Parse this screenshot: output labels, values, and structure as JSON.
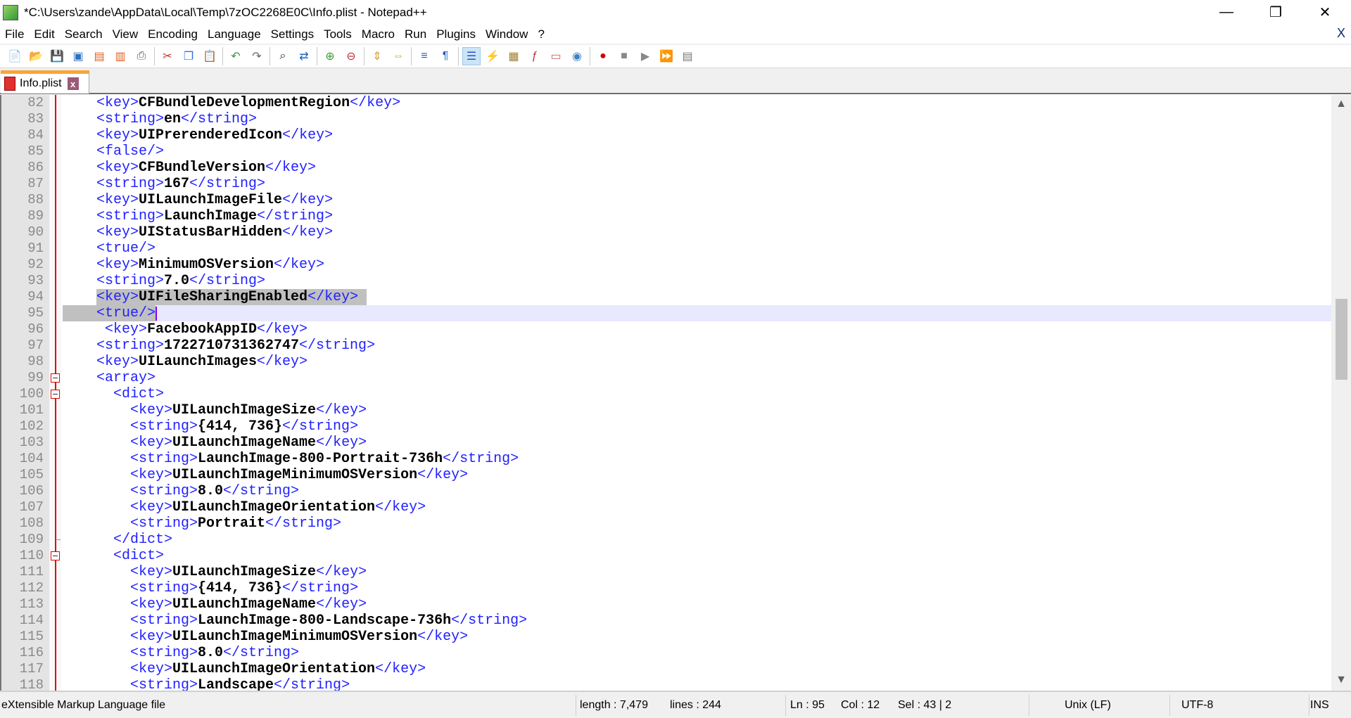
{
  "window": {
    "title": "*C:\\Users\\zande\\AppData\\Local\\Temp\\7zOC2268E0C\\Info.plist - Notepad++",
    "minimize": "—",
    "restore": "❐",
    "close": "✕"
  },
  "menu": {
    "items": [
      "File",
      "Edit",
      "Search",
      "View",
      "Encoding",
      "Language",
      "Settings",
      "Tools",
      "Macro",
      "Run",
      "Plugins",
      "Window",
      "?"
    ],
    "close": "X"
  },
  "toolbar": {
    "icons": [
      "new-file",
      "open-file",
      "save",
      "save-all",
      "close",
      "close-all",
      "print",
      "|",
      "cut",
      "copy",
      "paste",
      "|",
      "undo",
      "redo",
      "|",
      "find",
      "replace",
      "|",
      "zoom-in",
      "zoom-out",
      "|",
      "sync-vertical",
      "sync-horizontal",
      "|",
      "word-wrap",
      "show-all-chars",
      "|",
      "indent-guide",
      "user-language",
      "document-map",
      "function-list",
      "folder-workspace",
      "monitoring",
      "|",
      "record-macro",
      "stop-record",
      "play-macro",
      "run-macro-multiple",
      "save-macro"
    ],
    "active": "indent-guide"
  },
  "tab": {
    "label": "Info.plist",
    "close": "x",
    "accent": "#f9a53a"
  },
  "colors": {
    "tag": "#2020ff",
    "value": "#000000",
    "current_line": "#e8e8ff",
    "selection": "#c0c0c0"
  },
  "editor": {
    "lines": [
      {
        "n": "82",
        "i": 4,
        "s": [
          [
            "t",
            "<key>"
          ],
          [
            "v",
            "CFBundleDevelopmentRegion"
          ],
          [
            "t",
            "</key>"
          ]
        ]
      },
      {
        "n": "83",
        "i": 4,
        "s": [
          [
            "t",
            "<string>"
          ],
          [
            "v",
            "en"
          ],
          [
            "t",
            "</string>"
          ]
        ]
      },
      {
        "n": "84",
        "i": 4,
        "s": [
          [
            "t",
            "<key>"
          ],
          [
            "v",
            "UIPrerenderedIcon"
          ],
          [
            "t",
            "</key>"
          ]
        ]
      },
      {
        "n": "85",
        "i": 4,
        "s": [
          [
            "t",
            "<false/>"
          ]
        ]
      },
      {
        "n": "86",
        "i": 4,
        "s": [
          [
            "t",
            "<key>"
          ],
          [
            "v",
            "CFBundleVersion"
          ],
          [
            "t",
            "</key>"
          ]
        ]
      },
      {
        "n": "87",
        "i": 4,
        "s": [
          [
            "t",
            "<string>"
          ],
          [
            "v",
            "167"
          ],
          [
            "t",
            "</string>"
          ]
        ]
      },
      {
        "n": "88",
        "i": 4,
        "s": [
          [
            "t",
            "<key>"
          ],
          [
            "v",
            "UILaunchImageFile"
          ],
          [
            "t",
            "</key>"
          ]
        ]
      },
      {
        "n": "89",
        "i": 4,
        "s": [
          [
            "t",
            "<string>"
          ],
          [
            "v",
            "LaunchImage"
          ],
          [
            "t",
            "</string>"
          ]
        ]
      },
      {
        "n": "90",
        "i": 4,
        "s": [
          [
            "t",
            "<key>"
          ],
          [
            "v",
            "UIStatusBarHidden"
          ],
          [
            "t",
            "</key>"
          ]
        ]
      },
      {
        "n": "91",
        "i": 4,
        "s": [
          [
            "t",
            "<true/>"
          ]
        ]
      },
      {
        "n": "92",
        "i": 4,
        "s": [
          [
            "t",
            "<key>"
          ],
          [
            "v",
            "MinimumOSVersion"
          ],
          [
            "t",
            "</key>"
          ]
        ]
      },
      {
        "n": "93",
        "i": 4,
        "s": [
          [
            "t",
            "<string>"
          ],
          [
            "v",
            "7.0"
          ],
          [
            "t",
            "</string>"
          ]
        ]
      },
      {
        "n": "94",
        "i": 4,
        "s": [
          [
            "t",
            "<key>"
          ],
          [
            "v",
            "UIFileSharingEnabled"
          ],
          [
            "t",
            "</key>"
          ]
        ]
      },
      {
        "n": "95",
        "i": 4,
        "s": [
          [
            "t",
            "<true/>"
          ]
        ]
      },
      {
        "n": "96",
        "i": 5,
        "s": [
          [
            "t",
            "<key>"
          ],
          [
            "v",
            "FacebookAppID"
          ],
          [
            "t",
            "</key>"
          ]
        ]
      },
      {
        "n": "97",
        "i": 4,
        "s": [
          [
            "t",
            "<string>"
          ],
          [
            "v",
            "1722710731362747"
          ],
          [
            "t",
            "</string>"
          ]
        ]
      },
      {
        "n": "98",
        "i": 4,
        "s": [
          [
            "t",
            "<key>"
          ],
          [
            "v",
            "UILaunchImages"
          ],
          [
            "t",
            "</key>"
          ]
        ]
      },
      {
        "n": "99",
        "i": 4,
        "s": [
          [
            "t",
            "<array>"
          ]
        ],
        "fold": "open"
      },
      {
        "n": "100",
        "i": 6,
        "s": [
          [
            "t",
            "<dict>"
          ]
        ],
        "fold": "open"
      },
      {
        "n": "101",
        "i": 8,
        "s": [
          [
            "t",
            "<key>"
          ],
          [
            "v",
            "UILaunchImageSize"
          ],
          [
            "t",
            "</key>"
          ]
        ]
      },
      {
        "n": "102",
        "i": 8,
        "s": [
          [
            "t",
            "<string>"
          ],
          [
            "v",
            "{414, 736}"
          ],
          [
            "t",
            "</string>"
          ]
        ]
      },
      {
        "n": "103",
        "i": 8,
        "s": [
          [
            "t",
            "<key>"
          ],
          [
            "v",
            "UILaunchImageName"
          ],
          [
            "t",
            "</key>"
          ]
        ]
      },
      {
        "n": "104",
        "i": 8,
        "s": [
          [
            "t",
            "<string>"
          ],
          [
            "v",
            "LaunchImage-800-Portrait-736h"
          ],
          [
            "t",
            "</string>"
          ]
        ]
      },
      {
        "n": "105",
        "i": 8,
        "s": [
          [
            "t",
            "<key>"
          ],
          [
            "v",
            "UILaunchImageMinimumOSVersion"
          ],
          [
            "t",
            "</key>"
          ]
        ]
      },
      {
        "n": "106",
        "i": 8,
        "s": [
          [
            "t",
            "<string>"
          ],
          [
            "v",
            "8.0"
          ],
          [
            "t",
            "</string>"
          ]
        ]
      },
      {
        "n": "107",
        "i": 8,
        "s": [
          [
            "t",
            "<key>"
          ],
          [
            "v",
            "UILaunchImageOrientation"
          ],
          [
            "t",
            "</key>"
          ]
        ]
      },
      {
        "n": "108",
        "i": 8,
        "s": [
          [
            "t",
            "<string>"
          ],
          [
            "v",
            "Portrait"
          ],
          [
            "t",
            "</string>"
          ]
        ]
      },
      {
        "n": "109",
        "i": 6,
        "s": [
          [
            "t",
            "</dict>"
          ]
        ],
        "fold": "end"
      },
      {
        "n": "110",
        "i": 6,
        "s": [
          [
            "t",
            "<dict>"
          ]
        ],
        "fold": "open"
      },
      {
        "n": "111",
        "i": 8,
        "s": [
          [
            "t",
            "<key>"
          ],
          [
            "v",
            "UILaunchImageSize"
          ],
          [
            "t",
            "</key>"
          ]
        ]
      },
      {
        "n": "112",
        "i": 8,
        "s": [
          [
            "t",
            "<string>"
          ],
          [
            "v",
            "{414, 736}"
          ],
          [
            "t",
            "</string>"
          ]
        ]
      },
      {
        "n": "113",
        "i": 8,
        "s": [
          [
            "t",
            "<key>"
          ],
          [
            "v",
            "UILaunchImageName"
          ],
          [
            "t",
            "</key>"
          ]
        ]
      },
      {
        "n": "114",
        "i": 8,
        "s": [
          [
            "t",
            "<string>"
          ],
          [
            "v",
            "LaunchImage-800-Landscape-736h"
          ],
          [
            "t",
            "</string>"
          ]
        ]
      },
      {
        "n": "115",
        "i": 8,
        "s": [
          [
            "t",
            "<key>"
          ],
          [
            "v",
            "UILaunchImageMinimumOSVersion"
          ],
          [
            "t",
            "</key>"
          ]
        ]
      },
      {
        "n": "116",
        "i": 8,
        "s": [
          [
            "t",
            "<string>"
          ],
          [
            "v",
            "8.0"
          ],
          [
            "t",
            "</string>"
          ]
        ]
      },
      {
        "n": "117",
        "i": 8,
        "s": [
          [
            "t",
            "<key>"
          ],
          [
            "v",
            "UILaunchImageOrientation"
          ],
          [
            "t",
            "</key>"
          ]
        ]
      },
      {
        "n": "118",
        "i": 8,
        "s": [
          [
            "t",
            "<string>"
          ],
          [
            "v",
            "Landscape"
          ],
          [
            "t",
            "</string>"
          ]
        ]
      }
    ],
    "current_line": "95"
  },
  "scrollbar": {
    "up": "▲",
    "down": "▼",
    "position_percent": 35
  },
  "status": {
    "filetype": "eXtensible Markup Language file",
    "length": "length : 7,479",
    "lines": "lines : 244",
    "ln": "Ln : 95",
    "col": "Col : 12",
    "sel": "Sel : 43 | 2",
    "eol": "Unix (LF)",
    "encoding": "UTF-8",
    "mode": "INS"
  }
}
